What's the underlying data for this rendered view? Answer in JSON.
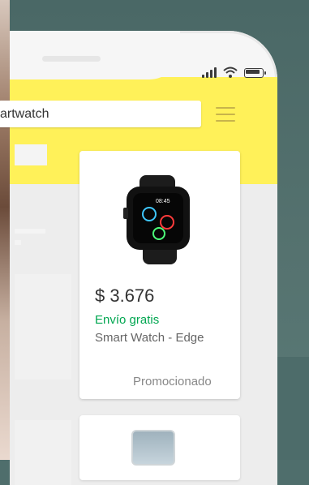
{
  "search": {
    "value": "artwatch"
  },
  "product": {
    "price": "$ 3.676",
    "shipping": "Envío gratis",
    "title": "Smart Watch - Edge",
    "badge": "Promocionado",
    "watch_time": "08:45"
  },
  "colors": {
    "header_yellow": "#fff159",
    "shipping_green": "#00a650",
    "background_teal": "#4f6e6c"
  },
  "icons": {
    "signal": "signal-icon",
    "wifi": "wifi-icon",
    "battery": "battery-icon",
    "menu": "hamburger-menu-icon"
  }
}
